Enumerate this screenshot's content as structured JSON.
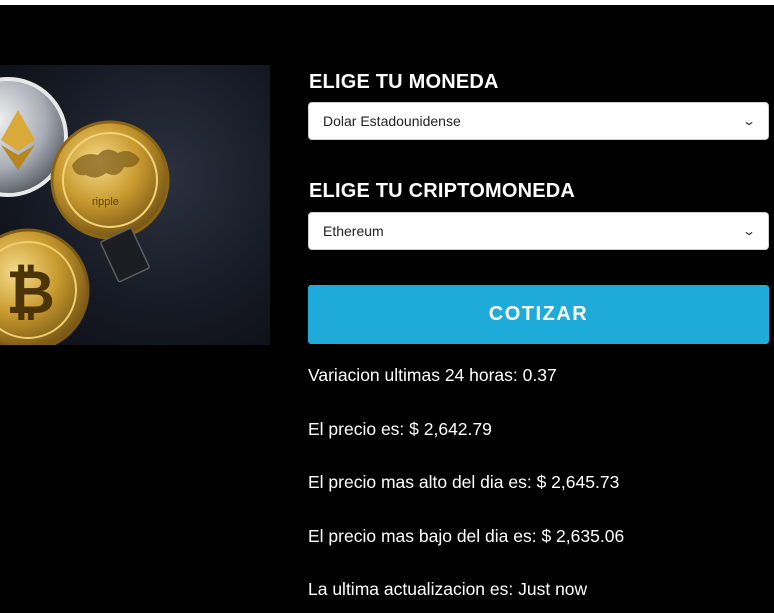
{
  "form": {
    "currency_label": "ELIGE TU MONEDA",
    "currency_value": "Dolar Estadounidense",
    "crypto_label": "ELIGE TU CRIPTOMONEDA",
    "crypto_value": "Ethereum",
    "submit_label": "COTIZAR"
  },
  "hero": {
    "coin_text": "ripple",
    "icon": "crypto-coins-image"
  },
  "results": [
    "Variacion ultimas 24 horas: 0.37",
    "El precio es: $ 2,642.79",
    "El precio mas alto del dia es: $ 2,645.73",
    "El precio mas bajo del dia es: $ 2,635.06",
    "La ultima actualizacion es: Just now"
  ],
  "colors": {
    "accent": "#1fabd9",
    "background": "#000000"
  }
}
